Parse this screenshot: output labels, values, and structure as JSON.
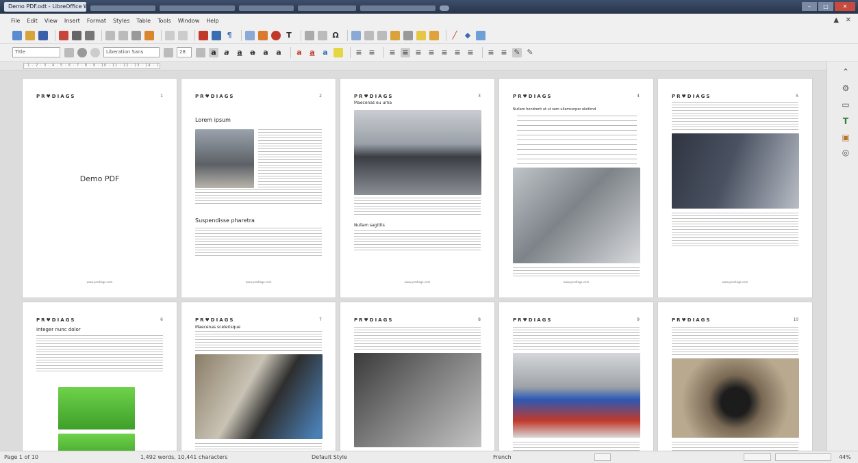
{
  "window": {
    "active_tab": "Demo PDF.odt - LibreOffice Writer",
    "other_tabs": [
      "",
      "",
      "",
      "",
      "",
      ""
    ]
  },
  "menu": [
    "File",
    "Edit",
    "View",
    "Insert",
    "Format",
    "Styles",
    "Table",
    "Tools",
    "Window",
    "Help"
  ],
  "format_toolbar": {
    "paragraph_style": "Title",
    "font_name": "Liberation Sans",
    "font_size": "28"
  },
  "document": {
    "logo": "PR♥DIAGS",
    "footer": "www.prodiags.com",
    "pages": [
      {
        "number": "1",
        "title": "Demo PDF"
      },
      {
        "number": "2",
        "heading1": "Lorem ipsum",
        "heading2": "Suspendisse pharetra"
      },
      {
        "number": "3",
        "heading1": "Maecenas eu urna",
        "heading2": "Nullam sagittis"
      },
      {
        "number": "4",
        "heading1": "Nullam hendrerit ut ut sem ullamcorper eleifend"
      },
      {
        "number": "5"
      },
      {
        "number": "6",
        "heading1": "Integer nunc dolor"
      },
      {
        "number": "7",
        "heading1": "Maecenas scelerisque"
      },
      {
        "number": "8"
      },
      {
        "number": "9"
      },
      {
        "number": "10"
      }
    ]
  },
  "status": {
    "page": "Page 1 of 10",
    "words": "1,492 words, 10,441 characters",
    "page_style": "Default Style",
    "language": "French",
    "zoom": "44%"
  }
}
